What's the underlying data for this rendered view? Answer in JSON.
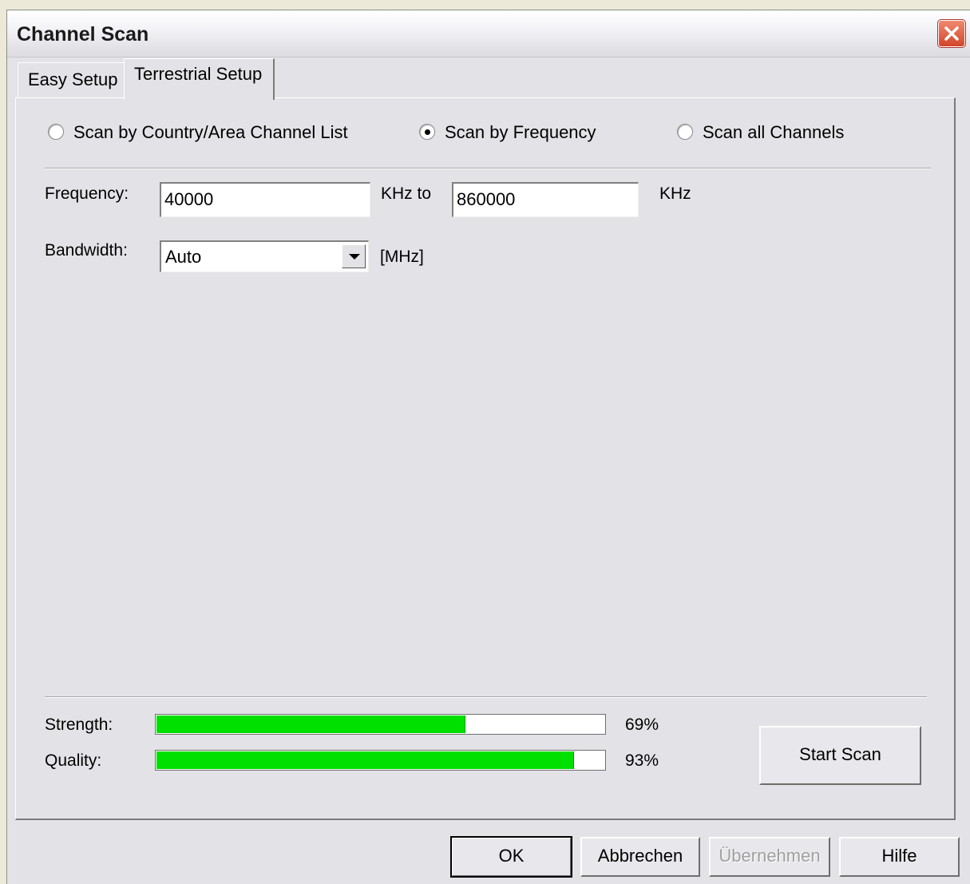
{
  "window": {
    "title": "Channel Scan"
  },
  "tabs": [
    {
      "label": "Easy Setup",
      "active": false
    },
    {
      "label": "Terrestrial Setup",
      "active": true
    }
  ],
  "scan_mode": {
    "options": [
      {
        "label": "Scan by Country/Area Channel List",
        "checked": false
      },
      {
        "label": "Scan by Frequency",
        "checked": true
      },
      {
        "label": "Scan all Channels",
        "checked": false
      }
    ]
  },
  "frequency": {
    "label": "Frequency:",
    "from_value": "40000",
    "to_label": "KHz to",
    "to_value": "860000",
    "unit": "KHz"
  },
  "bandwidth": {
    "label": "Bandwidth:",
    "selected": "Auto",
    "unit": "[MHz]"
  },
  "signal": {
    "strength": {
      "label": "Strength:",
      "percent": 69,
      "text": "69%"
    },
    "quality": {
      "label": "Quality:",
      "percent": 93,
      "text": "93%"
    }
  },
  "actions": {
    "start_scan": "Start Scan"
  },
  "footer": {
    "ok": "OK",
    "cancel": "Abbrechen",
    "apply": "Übernehmen",
    "help": "Hilfe"
  },
  "colors": {
    "signal_bar": "#00e000",
    "close_button": "#d2452a"
  },
  "icons": {
    "close": "close-icon",
    "dropdown": "chevron-down-icon"
  }
}
